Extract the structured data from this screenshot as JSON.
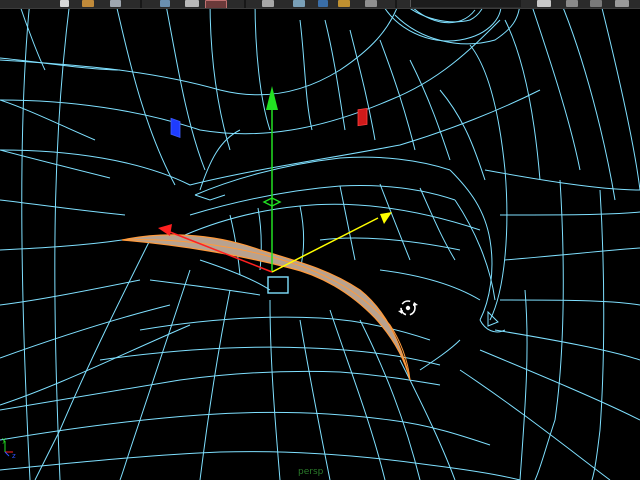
{
  "viewport": {
    "camera_label": "persp",
    "wireframe_color": "#7fe0ff",
    "background_color": "#000000",
    "selection_face_color": "#b8a28f",
    "selection_edge_color": "#ff9a3c"
  },
  "manipulator": {
    "x_axis_color": "#ff2020",
    "y_axis_color": "#22e022",
    "z_axis_color": "#ffff00",
    "center_color": "#7fe0ff",
    "icon": "rotate-pivot-icon"
  },
  "markers": {
    "blue_color": "#1e3cff",
    "red_color": "#d01a1a"
  },
  "axis_indicator": {
    "x_label": "x",
    "y_label": "y",
    "z_label": "z"
  },
  "toolbar": {
    "tools": [
      "new-scene-icon",
      "open-scene-icon",
      "save-scene-icon",
      "select-tool-icon",
      "lasso-tool-icon",
      "paint-select-icon",
      "snap-grid-icon",
      "snap-curve-icon",
      "snap-point-icon",
      "snap-view-plane-icon",
      "make-live-icon",
      "render-icon",
      "ipr-render-icon"
    ]
  }
}
